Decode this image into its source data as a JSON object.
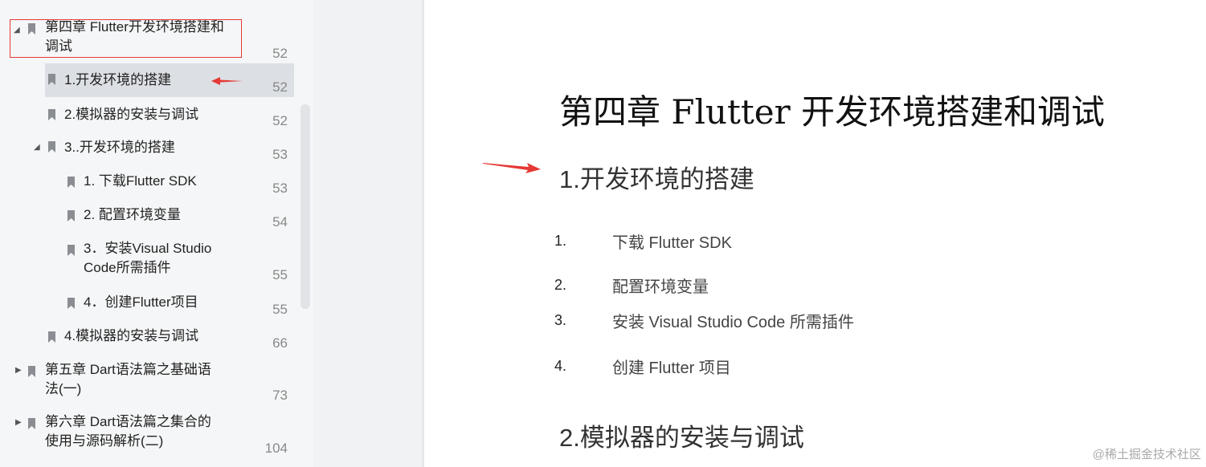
{
  "sidebar": {
    "items": [
      {
        "label": "第四章 Flutter开发环境搭建和调试",
        "page": "52",
        "expanded": true
      },
      {
        "label": "1.开发环境的搭建",
        "page": "52",
        "selected": true
      },
      {
        "label": "2.模拟器的安装与调试",
        "page": "52"
      },
      {
        "label": "3..开发环境的搭建",
        "page": "53",
        "expanded": true
      },
      {
        "label": "1. 下载Flutter SDK",
        "page": "53"
      },
      {
        "label": "2. 配置环境变量",
        "page": "54"
      },
      {
        "label": "3．安装Visual Studio Code所需插件",
        "page": "55"
      },
      {
        "label": "4．创建Flutter项目",
        "page": "55"
      },
      {
        "label": "4.模拟器的安装与调试",
        "page": "66"
      },
      {
        "label": "第五章 Dart语法篇之基础语法(一)",
        "page": "73",
        "expanded": false
      },
      {
        "label": "第六章 Dart语法篇之集合的使用与源码解析(二)",
        "page": "104",
        "expanded": false
      }
    ]
  },
  "document": {
    "title": "第四章 Flutter 开发环境搭建和调试",
    "section1": "1.开发环境的搭建",
    "list": [
      {
        "num": "1.",
        "text": "下载 Flutter SDK"
      },
      {
        "num": "2.",
        "text": "配置环境变量"
      },
      {
        "num": "3.",
        "text": "安装 Visual Studio Code 所需插件"
      },
      {
        "num": "4.",
        "text": "创建 Flutter 项目"
      }
    ],
    "section2": "2.模拟器的安装与调试"
  },
  "watermark": "@稀土掘金技术社区",
  "colors": {
    "annotation": "#e53935",
    "sidebar_bg": "#f5f6f7",
    "selected_bg": "#dcdfe3"
  }
}
